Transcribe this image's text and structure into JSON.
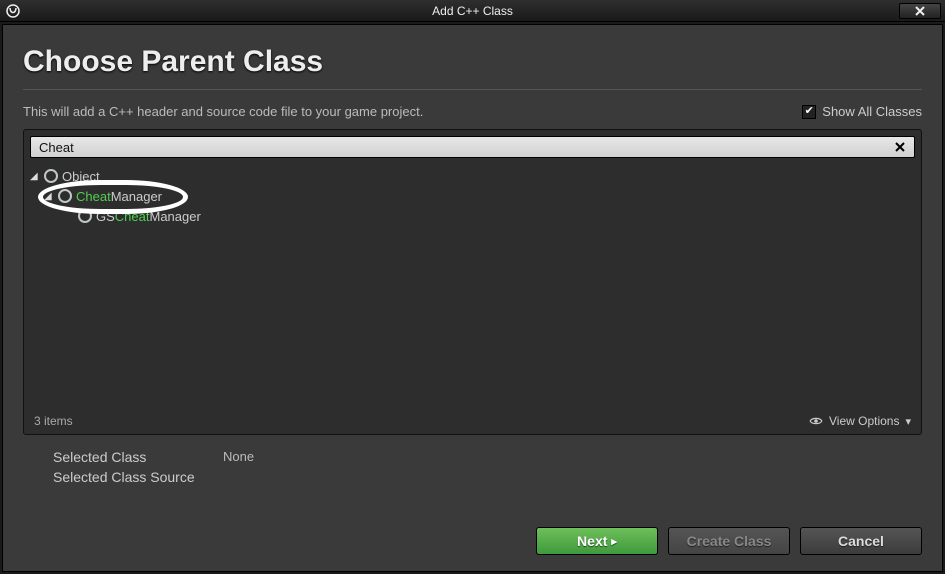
{
  "titlebar": {
    "title": "Add C++ Class"
  },
  "header": {
    "title": "Choose Parent Class"
  },
  "description": "This will add a C++ header and source code file to your game project.",
  "showAll": {
    "label": "Show All Classes",
    "checked": true
  },
  "search": {
    "value": "Cheat",
    "placeholder": "Search"
  },
  "tree": {
    "items": [
      {
        "indent": 0,
        "expanded": true,
        "label_pre": "",
        "match": "",
        "label_post": "Object"
      },
      {
        "indent": 1,
        "expanded": true,
        "label_pre": "",
        "match": "Cheat",
        "label_post": "Manager"
      },
      {
        "indent": 2,
        "expanded": false,
        "label_pre": "GS",
        "match": "Cheat",
        "label_post": "Manager"
      }
    ],
    "count_label": "3 items",
    "view_options_label": "View Options"
  },
  "selected": {
    "class_label": "Selected Class",
    "class_value": "None",
    "source_label": "Selected Class Source",
    "source_value": ""
  },
  "buttons": {
    "next": "Next",
    "create_class": "Create Class",
    "cancel": "Cancel"
  }
}
